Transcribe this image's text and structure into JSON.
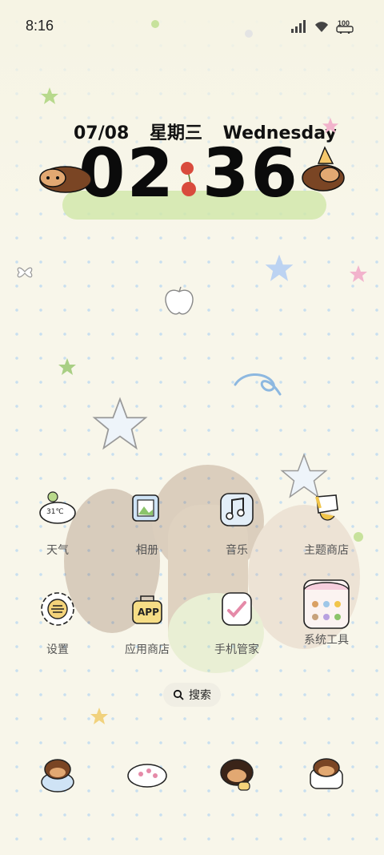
{
  "status_bar": {
    "time": "8:16",
    "battery": "100"
  },
  "clock": {
    "date": "07/08",
    "weekday_cn": "星期三",
    "weekday_en": "Wednesday",
    "hour": "02",
    "minute": "36"
  },
  "apps": [
    {
      "label": "天气",
      "icon": "weather-icon",
      "temp": "31℃"
    },
    {
      "label": "相册",
      "icon": "gallery-icon"
    },
    {
      "label": "音乐",
      "icon": "music-icon"
    },
    {
      "label": "主题商店",
      "icon": "theme-store-icon"
    },
    {
      "label": "设置",
      "icon": "settings-icon"
    },
    {
      "label": "应用商店",
      "icon": "app-store-icon",
      "badge": "APP"
    },
    {
      "label": "手机管家",
      "icon": "phone-manager-icon"
    },
    {
      "label": "系统工具",
      "icon": "system-tools-folder-icon"
    }
  ],
  "search": {
    "label": "搜索"
  },
  "dock": [
    "phone-icon",
    "messages-icon",
    "browser-icon",
    "camera-icon"
  ]
}
